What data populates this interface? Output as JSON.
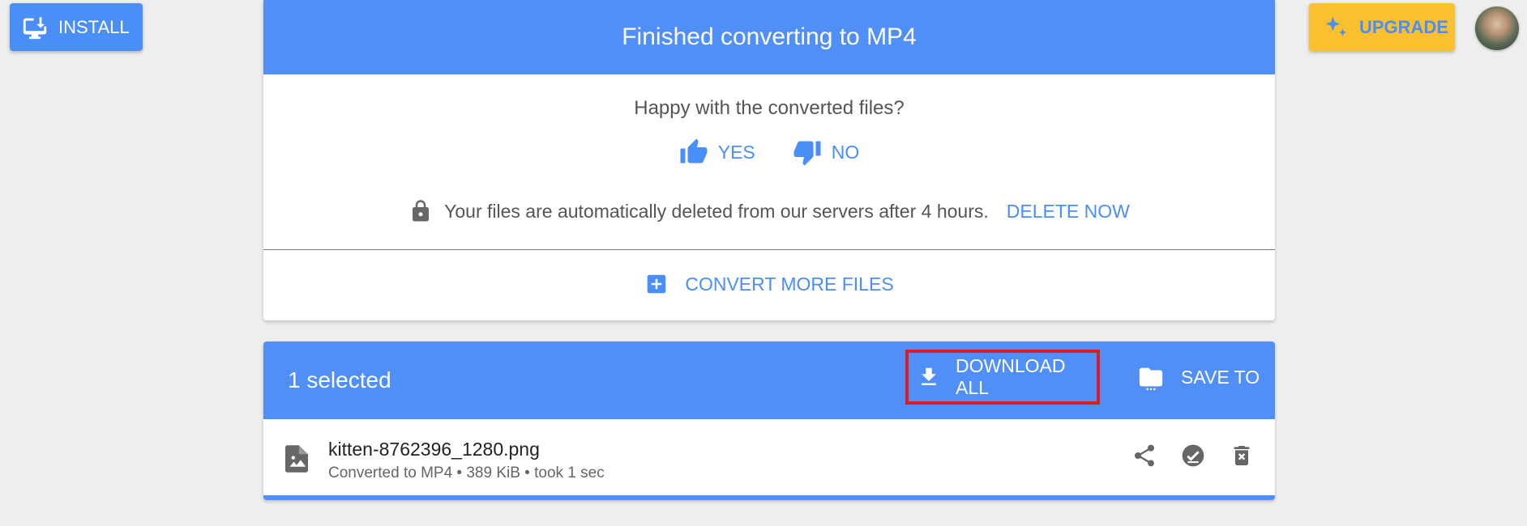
{
  "topbar": {
    "install_label": "INSTALL",
    "upgrade_label": "UPGRADE"
  },
  "result": {
    "title": "Finished converting to MP4",
    "feedback_question": "Happy with the converted files?",
    "yes_label": "YES",
    "no_label": "NO",
    "privacy_text": "Your files are automatically deleted from our servers after 4 hours.",
    "delete_now_label": "DELETE NOW",
    "convert_more_label": "CONVERT MORE FILES"
  },
  "file_list": {
    "selected_text": "1 selected",
    "download_all_label": "DOWNLOAD ALL",
    "save_to_label": "SAVE TO",
    "files": [
      {
        "name": "kitten-8762396_1280.png",
        "meta": "Converted to MP4 • 389 KiB • took 1 sec",
        "progress": 1.0
      }
    ]
  },
  "icons": {
    "install": "install-desktop-icon",
    "upgrade": "sparkle-icon",
    "yes": "thumb-up-icon",
    "no": "thumb-down-icon",
    "lock": "lock-icon",
    "convert_more": "add-box-icon",
    "download": "download-icon",
    "save_to": "folder-icon",
    "file": "image-file-icon",
    "share": "share-icon",
    "check": "check-circle-icon",
    "delete": "delete-icon"
  },
  "colors": {
    "accent": "#4f8ff7",
    "link": "#4a8ef8",
    "upgrade_bg": "#fbc02d",
    "highlight_border": "#e01b24",
    "page_bg": "#eeeeee"
  }
}
